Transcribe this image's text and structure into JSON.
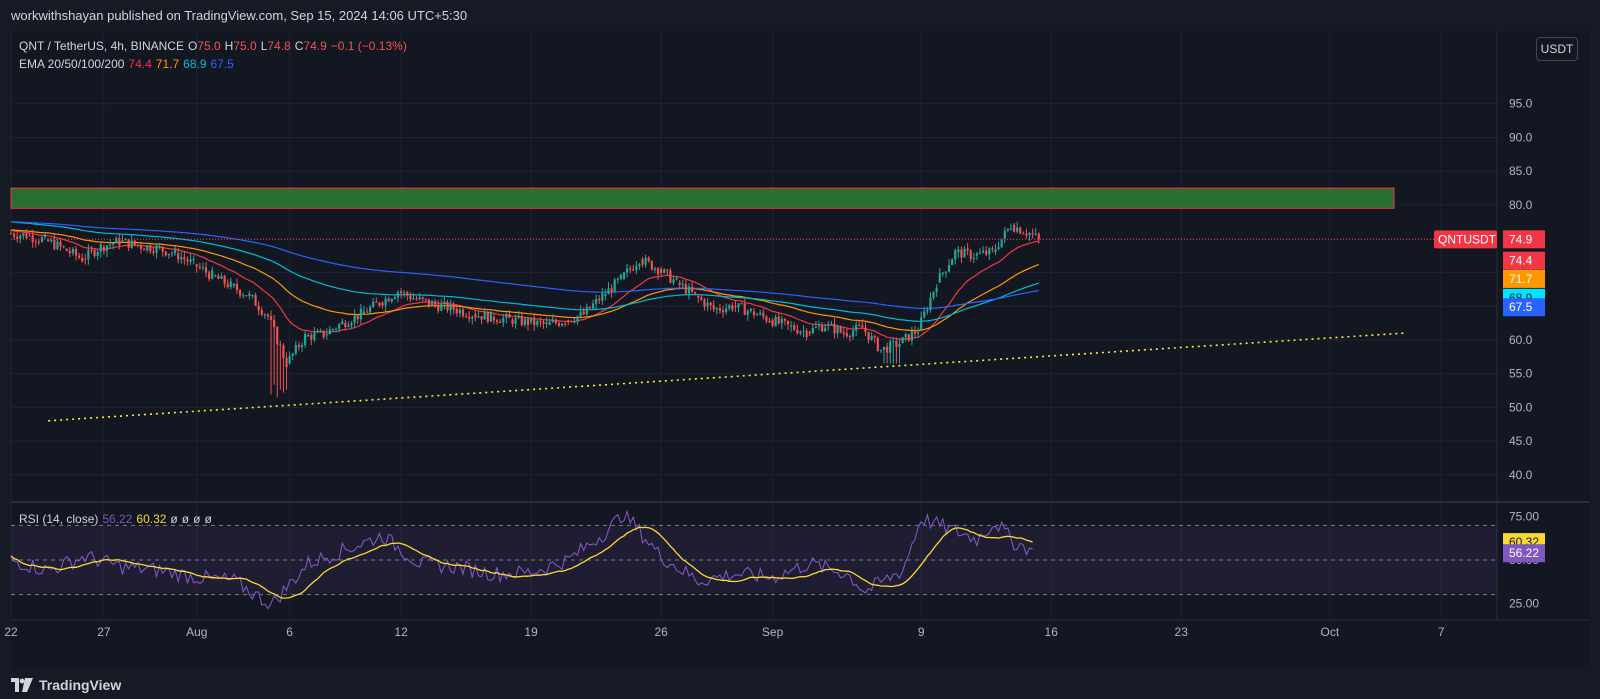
{
  "header": {
    "publisher": "workwithshayan published on TradingView.com, Sep 15, 2024 14:06 UTC+5:30"
  },
  "legend": {
    "symbol": "QNT / TetherUS, 4h, BINANCE",
    "open_label": "O",
    "open": "75.0",
    "high_label": "H",
    "high": "75.0",
    "low_label": "L",
    "low": "74.8",
    "close_label": "C",
    "close": "74.9",
    "change": "−0.1 (−0.13%)",
    "ema_label": "EMA 20/50/100/200",
    "ema_values": [
      "74.4",
      "71.7",
      "68.9",
      "67.5"
    ],
    "rsi_label": "RSI (14, close)",
    "rsi_value": "56.22",
    "rsi_ma": "60.32",
    "rsi_extra": [
      "ø",
      "ø",
      "ø",
      "ø"
    ]
  },
  "toolbar": {
    "currency": "USDT"
  },
  "footer": {
    "brand": "TradingView"
  },
  "colors": {
    "up": "#26a69a",
    "down": "#ef5350",
    "ema20": "#f23645",
    "ema50": "#ff9800",
    "ema100": "#00bcd4",
    "ema200": "#2962ff",
    "rsi": "#7e57c2",
    "rsi_ma": "#fdd835",
    "zone": "#2e7d32",
    "trend": "#ffeb3b"
  },
  "chart_data": {
    "type": "candlestick",
    "symbol": "QNTUSDT",
    "interval": "4h",
    "price_axis": {
      "ticks": [
        "95.0",
        "90.0",
        "85.0",
        "80.0",
        "75.0",
        "70.0",
        "65.0",
        "60.0",
        "55.0",
        "50.0",
        "45.0",
        "40.0"
      ],
      "range": [
        37,
        100
      ]
    },
    "time_axis": {
      "ticks": [
        "22",
        "27",
        "Aug",
        "6",
        "12",
        "19",
        "26",
        "Sep",
        "9",
        "16",
        "23",
        "Oct",
        "7"
      ],
      "range": [
        "2024-07-22",
        "2024-10-10"
      ]
    },
    "daily_close": [
      {
        "d": "2024-07-22",
        "c": 75.5
      },
      {
        "d": "2024-07-23",
        "c": 74.8
      },
      {
        "d": "2024-07-24",
        "c": 73.5
      },
      {
        "d": "2024-07-25",
        "c": 72.0
      },
      {
        "d": "2024-07-26",
        "c": 73.8
      },
      {
        "d": "2024-07-27",
        "c": 74.6
      },
      {
        "d": "2024-07-28",
        "c": 74.0
      },
      {
        "d": "2024-07-29",
        "c": 73.6
      },
      {
        "d": "2024-07-30",
        "c": 72.8
      },
      {
        "d": "2024-07-31",
        "c": 71.2
      },
      {
        "d": "2024-08-01",
        "c": 69.5
      },
      {
        "d": "2024-08-02",
        "c": 68.0
      },
      {
        "d": "2024-08-03",
        "c": 66.5
      },
      {
        "d": "2024-08-04",
        "c": 63.5
      },
      {
        "d": "2024-08-05",
        "c": 56.5
      },
      {
        "d": "2024-08-06",
        "c": 60.5
      },
      {
        "d": "2024-08-07",
        "c": 60.8
      },
      {
        "d": "2024-08-08",
        "c": 62.5
      },
      {
        "d": "2024-08-09",
        "c": 63.8
      },
      {
        "d": "2024-08-10",
        "c": 65.5
      },
      {
        "d": "2024-08-11",
        "c": 67.2
      },
      {
        "d": "2024-08-12",
        "c": 66.0
      },
      {
        "d": "2024-08-13",
        "c": 65.2
      },
      {
        "d": "2024-08-14",
        "c": 64.6
      },
      {
        "d": "2024-08-15",
        "c": 63.8
      },
      {
        "d": "2024-08-16",
        "c": 63.4
      },
      {
        "d": "2024-08-17",
        "c": 63.0
      },
      {
        "d": "2024-08-18",
        "c": 62.6
      },
      {
        "d": "2024-08-19",
        "c": 62.2
      },
      {
        "d": "2024-08-20",
        "c": 62.9
      },
      {
        "d": "2024-08-21",
        "c": 63.8
      },
      {
        "d": "2024-08-22",
        "c": 66.5
      },
      {
        "d": "2024-08-23",
        "c": 69.0
      },
      {
        "d": "2024-08-24",
        "c": 72.0
      },
      {
        "d": "2024-08-25",
        "c": 70.5
      },
      {
        "d": "2024-08-26",
        "c": 68.5
      },
      {
        "d": "2024-08-27",
        "c": 66.5
      },
      {
        "d": "2024-08-28",
        "c": 64.5
      },
      {
        "d": "2024-08-29",
        "c": 65.0
      },
      {
        "d": "2024-08-30",
        "c": 64.2
      },
      {
        "d": "2024-08-31",
        "c": 63.0
      },
      {
        "d": "2024-09-01",
        "c": 62.0
      },
      {
        "d": "2024-09-02",
        "c": 61.2
      },
      {
        "d": "2024-09-03",
        "c": 62.2
      },
      {
        "d": "2024-09-04",
        "c": 61.0
      },
      {
        "d": "2024-09-05",
        "c": 61.8
      },
      {
        "d": "2024-09-06",
        "c": 58.5
      },
      {
        "d": "2024-09-07",
        "c": 59.5
      },
      {
        "d": "2024-09-08",
        "c": 61.5
      },
      {
        "d": "2024-09-09",
        "c": 68.5
      },
      {
        "d": "2024-09-10",
        "c": 73.0
      },
      {
        "d": "2024-09-11",
        "c": 72.5
      },
      {
        "d": "2024-09-12",
        "c": 73.0
      },
      {
        "d": "2024-09-13",
        "c": 77.0
      },
      {
        "d": "2024-09-14",
        "c": 75.8
      },
      {
        "d": "2024-09-15",
        "c": 74.9
      }
    ],
    "current_price": {
      "label": "QNTUSDT",
      "value": "74.9"
    },
    "ema_axis_labels": [
      "74.4",
      "71.7",
      "68.9",
      "67.5"
    ],
    "resistance_zone": {
      "from": 79.5,
      "to": 82.5
    },
    "trendline": {
      "start": {
        "d": "2024-07-24",
        "v": 48.0
      },
      "end": {
        "d": "2024-10-05",
        "v": 61.0
      }
    },
    "rsi": {
      "axis_ticks": [
        "75.00",
        "50.00",
        "25.00"
      ],
      "levels": [
        70,
        50,
        30
      ],
      "range": [
        20,
        80
      ],
      "daily": [
        {
          "d": "2024-07-22",
          "v": 50
        },
        {
          "d": "2024-07-24",
          "v": 44
        },
        {
          "d": "2024-07-26",
          "v": 52
        },
        {
          "d": "2024-07-28",
          "v": 46
        },
        {
          "d": "2024-07-30",
          "v": 44
        },
        {
          "d": "2024-08-01",
          "v": 40
        },
        {
          "d": "2024-08-03",
          "v": 38
        },
        {
          "d": "2024-08-05",
          "v": 24
        },
        {
          "d": "2024-08-07",
          "v": 48
        },
        {
          "d": "2024-08-09",
          "v": 56
        },
        {
          "d": "2024-08-11",
          "v": 64
        },
        {
          "d": "2024-08-13",
          "v": 48
        },
        {
          "d": "2024-08-15",
          "v": 46
        },
        {
          "d": "2024-08-17",
          "v": 42
        },
        {
          "d": "2024-08-19",
          "v": 43
        },
        {
          "d": "2024-08-21",
          "v": 50
        },
        {
          "d": "2024-08-23",
          "v": 66
        },
        {
          "d": "2024-08-24",
          "v": 77
        },
        {
          "d": "2024-08-26",
          "v": 52
        },
        {
          "d": "2024-08-28",
          "v": 38
        },
        {
          "d": "2024-08-30",
          "v": 42
        },
        {
          "d": "2024-09-01",
          "v": 40
        },
        {
          "d": "2024-09-03",
          "v": 48
        },
        {
          "d": "2024-09-05",
          "v": 42
        },
        {
          "d": "2024-09-06",
          "v": 32
        },
        {
          "d": "2024-09-08",
          "v": 44
        },
        {
          "d": "2024-09-09",
          "v": 74
        },
        {
          "d": "2024-09-10",
          "v": 70
        },
        {
          "d": "2024-09-12",
          "v": 62
        },
        {
          "d": "2024-09-13",
          "v": 72
        },
        {
          "d": "2024-09-14",
          "v": 60
        },
        {
          "d": "2024-09-15",
          "v": 56
        }
      ],
      "values": {
        "rsi": "56.22",
        "ma": "60.32"
      }
    }
  }
}
